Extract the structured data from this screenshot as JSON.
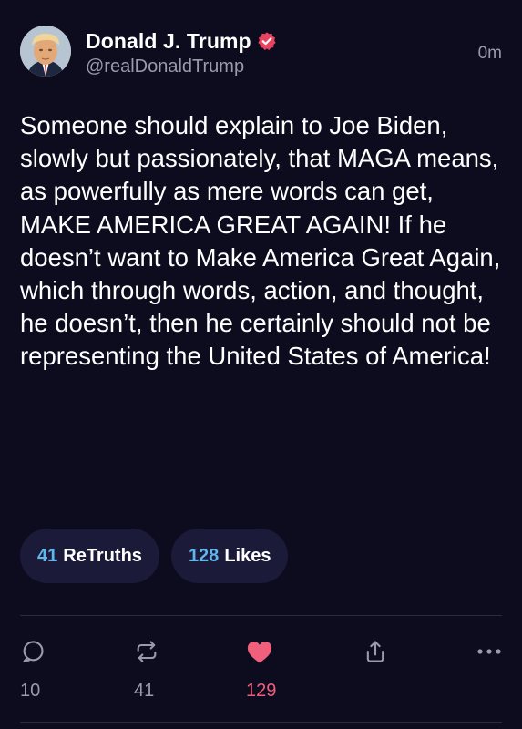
{
  "author": {
    "display_name": "Donald J. Trump",
    "handle": "@realDonaldTrump",
    "verified": true
  },
  "timestamp": "0m",
  "post": {
    "text": "Someone should explain to Joe Biden, slowly but passionately, that MAGA means, as powerfully as mere words can get, MAKE AMERICA GREAT AGAIN! If he doesn’t want to Make America Great Again, which through words, action, and thought, he doesn’t, then he certainly should not be representing the United States of America!"
  },
  "stats": {
    "retruths_count": "41",
    "retruths_label": "ReTruths",
    "likes_count": "128",
    "likes_label": "Likes"
  },
  "actions": {
    "reply": {
      "icon": "reply-icon",
      "count": "10"
    },
    "retruth": {
      "icon": "retruth-icon",
      "count": "41"
    },
    "like": {
      "icon": "heart-icon",
      "count": "129",
      "active": true
    },
    "share": {
      "icon": "share-icon"
    },
    "more": {
      "icon": "more-icon"
    }
  },
  "colors": {
    "background": "#0d0b1e",
    "accent_blue": "#60b5ec",
    "like_pink": "#f05f7b",
    "verified_badge": "#e9435f",
    "muted_text": "#9a99ad",
    "pill_bg": "#1b1a38"
  }
}
